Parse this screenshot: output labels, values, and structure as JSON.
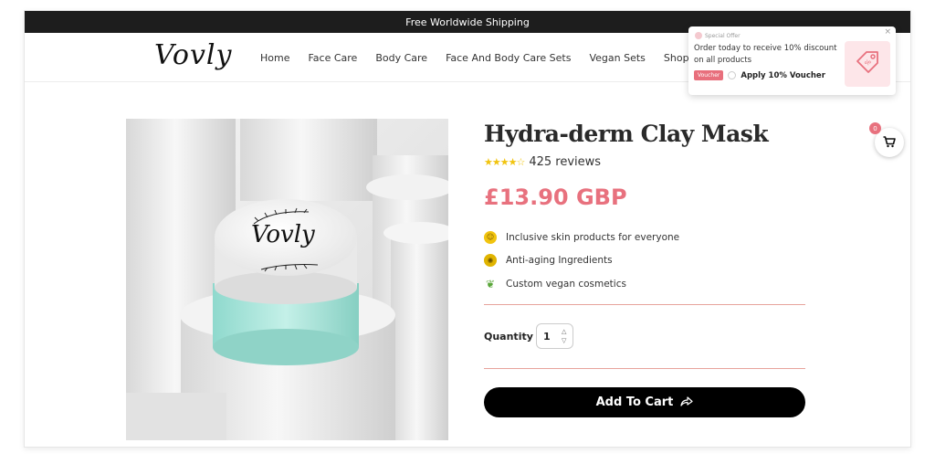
{
  "topbar": {
    "text": "Free Worldwide Shipping"
  },
  "header": {
    "logo": "Vovly",
    "nav": [
      {
        "label": "Home"
      },
      {
        "label": "Face Care"
      },
      {
        "label": "Body Care"
      },
      {
        "label": "Face And Body Care Sets"
      },
      {
        "label": "Vegan Sets"
      },
      {
        "label": "Shop"
      }
    ]
  },
  "offer": {
    "heading": "Special Offer",
    "text": "Order today to receive 10% discount on all products",
    "badge": "Voucher",
    "apply_label": "Apply 10% Voucher",
    "close": "×"
  },
  "product": {
    "image_logo": "Vovly",
    "title": "Hydra-derm Clay Mask",
    "stars": 4.5,
    "reviews": "425 reviews",
    "price": "£13.90 GBP",
    "features": [
      {
        "icon": "smile-icon",
        "color": "#f1c40f",
        "text": "Inclusive skin products for everyone"
      },
      {
        "icon": "sun-icon",
        "color": "#e0b400",
        "text": "Anti-aging Ingredients"
      },
      {
        "icon": "leaf-icon",
        "color": "#5aa63a",
        "text": "Custom vegan cosmetics"
      }
    ],
    "quantity_label": "Quantity",
    "quantity_value": "1",
    "add_to_cart": "Add To Cart"
  },
  "cart": {
    "count": "0"
  },
  "colors": {
    "accent": "#e8717e",
    "dark": "#1d1d1d",
    "divider": "#e7a39c"
  }
}
